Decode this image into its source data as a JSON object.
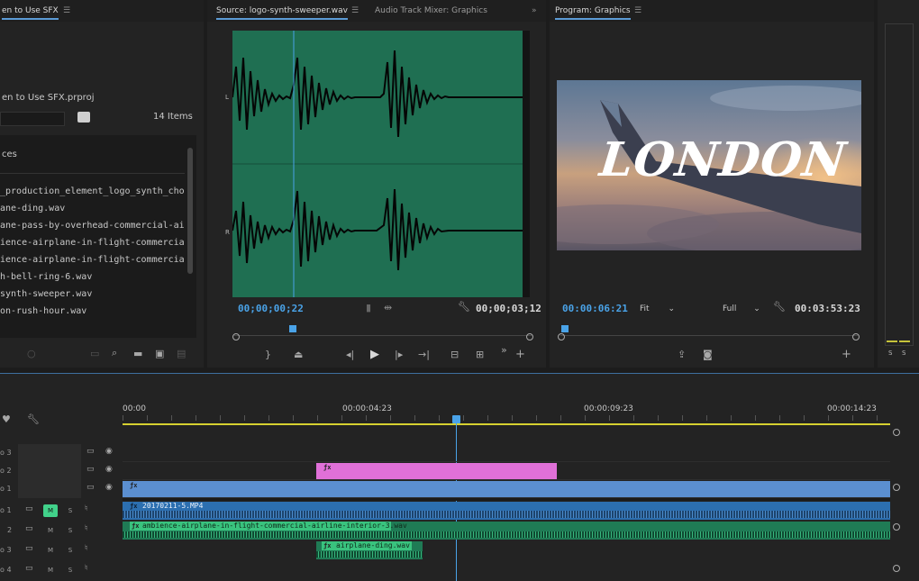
{
  "project_panel": {
    "tab_title": "en to Use SFX",
    "project_name": "en to Use SFX.prproj",
    "item_count": "14 Items",
    "column_header": "ces",
    "files": [
      "_production_element_logo_synth_cho.wav",
      "ane-ding.wav",
      "ane-pass-by-overhead-commercial-airlin",
      "ience-airplane-in-flight-commercial-airlin",
      "ience-airplane-in-flight-commercial-airlin",
      "h-bell-ring-6.wav",
      "synth-sweeper.wav",
      "on-rush-hour.wav"
    ]
  },
  "source_monitor": {
    "tab_title": "Source: logo-synth-sweeper.wav",
    "tab2_title": "Audio Track Mixer: Graphics",
    "current_tc": "00;00;00;22",
    "duration_tc": "00;00;03;12",
    "channel_left": "L",
    "channel_right": "R",
    "waveform_color": "#1f6f52"
  },
  "program_monitor": {
    "tab_title": "Program: Graphics",
    "current_tc": "00:00:06:21",
    "fit_label": "Fit",
    "full_label": "Full",
    "duration_tc": "00:03:53:23",
    "title_text": "LONDON"
  },
  "timeline": {
    "ruler": [
      "00:00",
      "00:00:04:23",
      "00:00:09:23",
      "00:00:14:23"
    ],
    "video_tracks": [
      "o 3",
      "o 2",
      "o 1"
    ],
    "audio_tracks": [
      "o 1",
      "2",
      "o 3",
      "o 4"
    ],
    "clips": {
      "v2_clip_name": "",
      "v1_clip_name": "",
      "a1_clip_name": "20170211-5.MP4",
      "a2_clip_name": "ambience-airplane-in-flight-commercial-airline-interior-3.wav",
      "a3_clip_name": "airplane-ding.wav"
    },
    "colors": {
      "graphic_clip": "#e070d8",
      "video_clip": "#5b8fd0",
      "audio_clip": "#2aa06a",
      "playhead": "#4aa3e8",
      "work_area": "#d6d030"
    }
  },
  "audio_meter": {
    "labels": [
      "S",
      "S"
    ]
  }
}
